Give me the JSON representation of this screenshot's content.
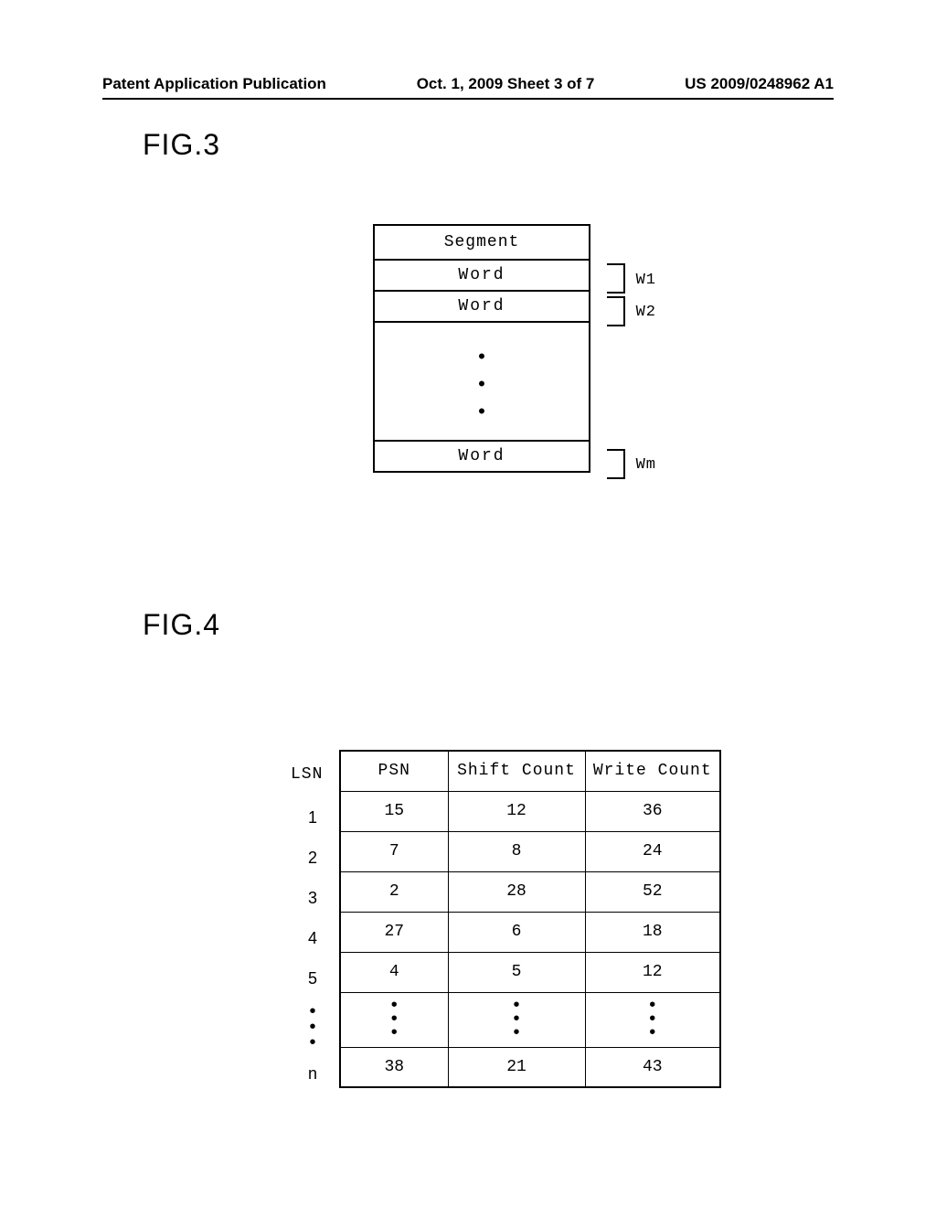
{
  "header": {
    "left": "Patent Application Publication",
    "center": "Oct. 1, 2009  Sheet 3 of 7",
    "right": "US 2009/0248962 A1"
  },
  "fig3": {
    "label": "FIG.3",
    "segment_title": "Segment",
    "word_text": "Word",
    "w1": "W1",
    "w2": "W2",
    "wm": "Wm"
  },
  "fig4": {
    "label": "FIG.4",
    "lsn_header": "LSN",
    "psn_header": "PSN",
    "shift_header": "Shift Count",
    "write_header": "Write Count",
    "rows": [
      {
        "lsn": "1",
        "psn": "15",
        "shift": "12",
        "write": "36"
      },
      {
        "lsn": "2",
        "psn": "7",
        "shift": "8",
        "write": "24"
      },
      {
        "lsn": "3",
        "psn": "2",
        "shift": "28",
        "write": "52"
      },
      {
        "lsn": "4",
        "psn": "27",
        "shift": "6",
        "write": "18"
      },
      {
        "lsn": "5",
        "psn": "4",
        "shift": "5",
        "write": "12"
      }
    ],
    "last": {
      "lsn": "n",
      "psn": "38",
      "shift": "21",
      "write": "43"
    }
  }
}
